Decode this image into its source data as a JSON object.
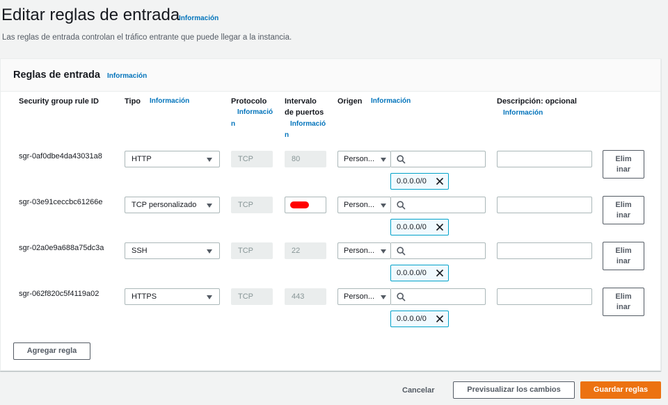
{
  "header": {
    "title": "Editar reglas de entrada",
    "info": "Información",
    "description": "Las reglas de entrada controlan el tráfico entrante que puede llegar a la instancia."
  },
  "panel": {
    "title": "Reglas de entrada",
    "info": "Información"
  },
  "columns": {
    "rule_id": "Security group rule ID",
    "type": "Tipo",
    "type_info": "Información",
    "protocol": "Protocolo",
    "protocol_info_a": "Informació",
    "protocol_info_b": "n",
    "port_range_a": "Intervalo",
    "port_range_b": "de puertos",
    "port_info_a": "Informació",
    "port_info_b": "n",
    "source": "Origen",
    "source_info": "Información",
    "description": "Descripción: opcional",
    "description_info": "Información"
  },
  "rules": [
    {
      "id": "sgr-0af0dbe4da43031a8",
      "type": "HTTP",
      "protocol": "TCP",
      "port": "80",
      "source": "Person...",
      "cidr": "0.0.0.0/0",
      "delete_a": "Elim",
      "delete_b": "inar"
    },
    {
      "id": "sgr-03e91ceccbc61266e",
      "type": "TCP personalizado",
      "protocol": "TCP",
      "port": "",
      "source": "Person...",
      "cidr": "0.0.0.0/0",
      "delete_a": "Elim",
      "delete_b": "inar"
    },
    {
      "id": "sgr-02a0e9a688a75dc3a",
      "type": "SSH",
      "protocol": "TCP",
      "port": "22",
      "source": "Person...",
      "cidr": "0.0.0.0/0",
      "delete_a": "Elim",
      "delete_b": "inar"
    },
    {
      "id": "sgr-062f820c5f4119a02",
      "type": "HTTPS",
      "protocol": "TCP",
      "port": "443",
      "source": "Person...",
      "cidr": "0.0.0.0/0",
      "delete_a": "Elim",
      "delete_b": "inar"
    }
  ],
  "add_rule": "Agregar regla",
  "footer": {
    "cancel": "Cancelar",
    "preview": "Previsualizar los cambios",
    "save": "Guardar reglas"
  },
  "icons": {
    "search": "search-icon",
    "remove": "close-icon",
    "dropdown": "caret-down-icon"
  },
  "colors": {
    "accent": "#ec7211",
    "link": "#0073bb",
    "token_border": "#00a1c9",
    "redaction": "#ff0000"
  }
}
